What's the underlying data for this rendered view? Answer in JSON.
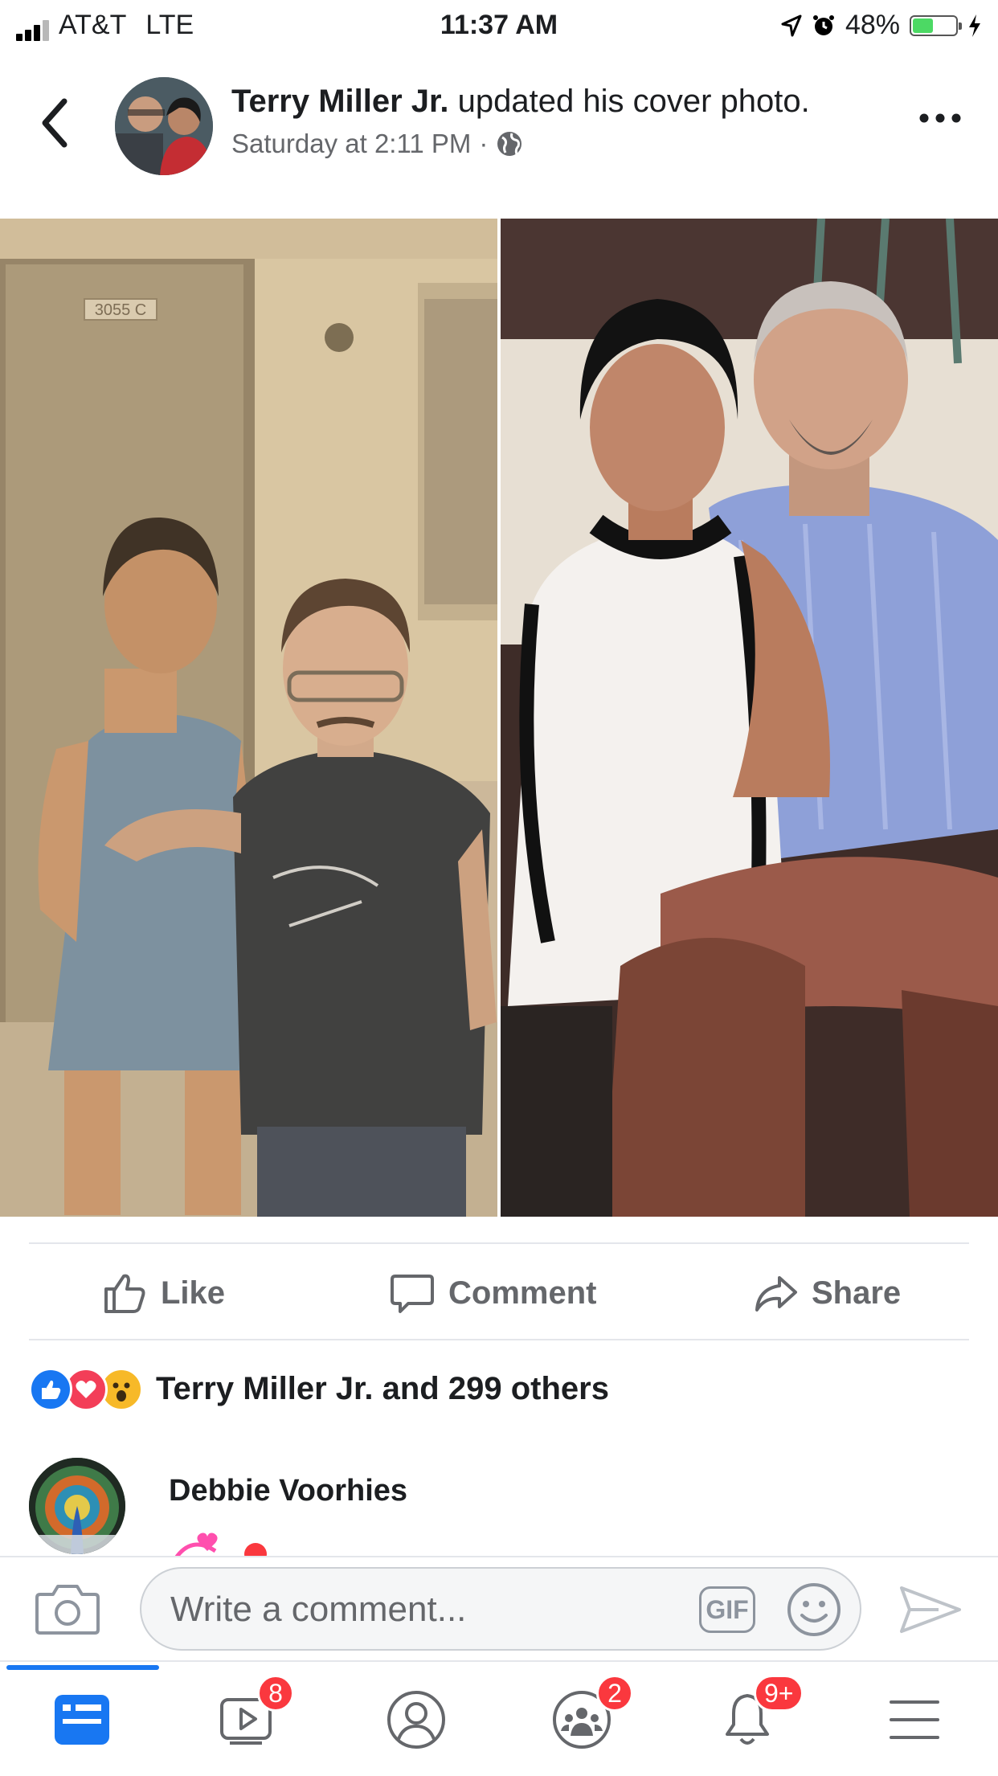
{
  "status_bar": {
    "carrier": "AT&T",
    "network": "LTE",
    "time": "11:37 AM",
    "battery": "48%",
    "battery_level": 0.48,
    "battery_color": "#4cd964"
  },
  "header": {
    "author": "Terry Miller Jr.",
    "action": "updated his cover photo.",
    "timestamp": "Saturday at 2:11 PM",
    "separator": "·",
    "privacy_icon": "globe-icon",
    "back_icon": "chevron-left-icon",
    "more_icon": "more-horizontal-icon"
  },
  "post": {
    "photo_door_number": "3055 C",
    "actions": {
      "like": "Like",
      "comment": "Comment",
      "share": "Share"
    },
    "reactions": {
      "icons": [
        "like-reaction-icon",
        "love-reaction-icon",
        "wow-reaction-icon"
      ],
      "summary": "Terry Miller Jr. and 299 others"
    }
  },
  "comments": [
    {
      "author": "Debbie Voorhies"
    }
  ],
  "composer": {
    "placeholder": "Write a comment...",
    "gif_label": "GIF"
  },
  "bottom_nav": {
    "items": [
      {
        "name": "news-feed",
        "icon": "news-feed-icon",
        "badge": ""
      },
      {
        "name": "watch",
        "icon": "video-icon",
        "badge": "8"
      },
      {
        "name": "profile",
        "icon": "profile-icon",
        "badge": ""
      },
      {
        "name": "groups",
        "icon": "groups-icon",
        "badge": "2"
      },
      {
        "name": "notifications",
        "icon": "bell-icon",
        "badge": "9+"
      },
      {
        "name": "menu",
        "icon": "menu-icon",
        "badge": ""
      }
    ]
  },
  "colors": {
    "accent": "#1877f2",
    "badge": "#fa383e",
    "secondary_text": "#65676b"
  }
}
